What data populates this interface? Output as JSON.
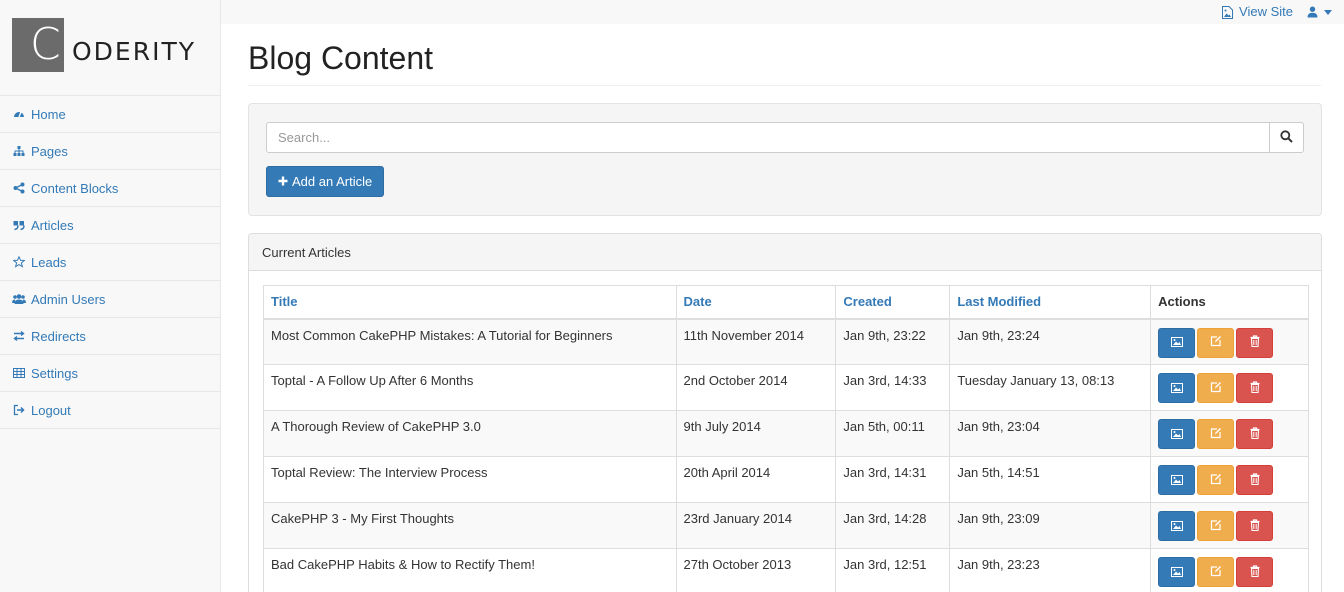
{
  "topbar": {
    "view_site": "View Site"
  },
  "logo": {
    "letter": "C",
    "rest": "ODERITY"
  },
  "sidebar": {
    "items": [
      {
        "label": "Home",
        "icon": "dashboard-icon"
      },
      {
        "label": "Pages",
        "icon": "sitemap-icon"
      },
      {
        "label": "Content Blocks",
        "icon": "share-icon"
      },
      {
        "label": "Articles",
        "icon": "quote-icon"
      },
      {
        "label": "Leads",
        "icon": "star-icon"
      },
      {
        "label": "Admin Users",
        "icon": "users-icon"
      },
      {
        "label": "Redirects",
        "icon": "exchange-icon"
      },
      {
        "label": "Settings",
        "icon": "table-icon"
      },
      {
        "label": "Logout",
        "icon": "sign-out-icon"
      }
    ]
  },
  "page": {
    "title": "Blog Content"
  },
  "search": {
    "placeholder": "Search...",
    "value": ""
  },
  "add_button": "Add an Article",
  "panel": {
    "heading": "Current Articles"
  },
  "table": {
    "headers": [
      "Title",
      "Date",
      "Created",
      "Last Modified",
      "Actions"
    ],
    "rows": [
      [
        "Most Common CakePHP Mistakes: A Tutorial for Beginners",
        "11th November 2014",
        "Jan 9th, 23:22",
        "Jan 9th, 23:24"
      ],
      [
        "Toptal - A Follow Up After 6 Months",
        "2nd October 2014",
        "Jan 3rd, 14:33",
        "Tuesday January 13, 08:13"
      ],
      [
        "A Thorough Review of CakePHP 3.0",
        "9th July 2014",
        "Jan 5th, 00:11",
        "Jan 9th, 23:04"
      ],
      [
        "Toptal Review: The Interview Process",
        "20th April 2014",
        "Jan 3rd, 14:31",
        "Jan 5th, 14:51"
      ],
      [
        "CakePHP 3 - My First Thoughts",
        "23rd January 2014",
        "Jan 3rd, 14:28",
        "Jan 9th, 23:09"
      ],
      [
        "Bad CakePHP Habits & How to Rectify Them!",
        "27th October 2013",
        "Jan 3rd, 12:51",
        "Jan 9th, 23:23"
      ]
    ]
  },
  "colors": {
    "primary": "#337ab7",
    "warning": "#f0ad4e",
    "danger": "#d9534f"
  }
}
